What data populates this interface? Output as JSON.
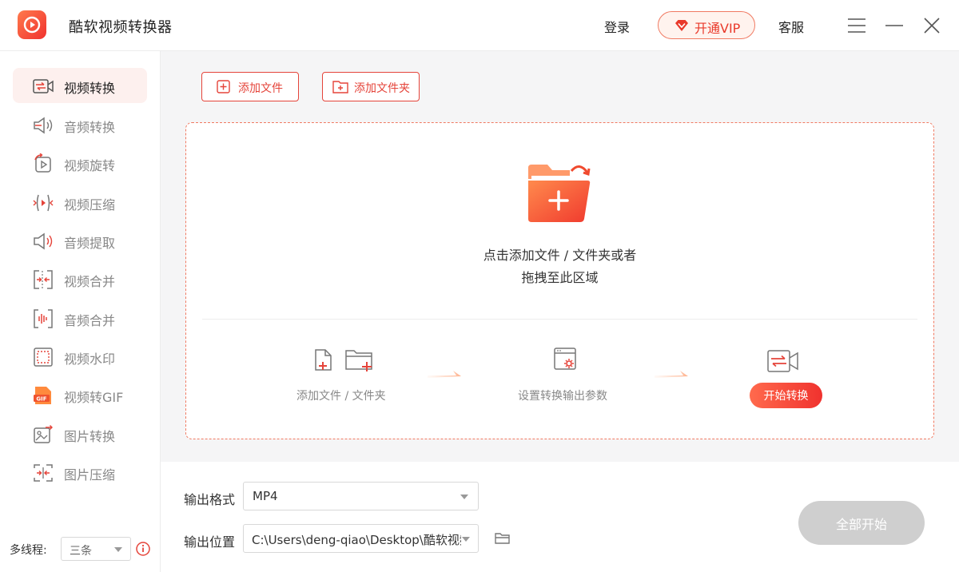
{
  "app": {
    "title": "酷软视频转换器"
  },
  "header": {
    "login": "登录",
    "vip": "开通VIP",
    "service": "客服"
  },
  "sidebar": {
    "items": [
      {
        "label": "视频转换",
        "icon": "video-convert-icon"
      },
      {
        "label": "音频转换",
        "icon": "audio-convert-icon"
      },
      {
        "label": "视频旋转",
        "icon": "video-rotate-icon"
      },
      {
        "label": "视频压缩",
        "icon": "video-compress-icon"
      },
      {
        "label": "音频提取",
        "icon": "audio-extract-icon"
      },
      {
        "label": "视频合并",
        "icon": "video-merge-icon"
      },
      {
        "label": "音频合并",
        "icon": "audio-merge-icon"
      },
      {
        "label": "视频水印",
        "icon": "video-watermark-icon"
      },
      {
        "label": "视频转GIF",
        "icon": "gif-icon"
      },
      {
        "label": "图片转换",
        "icon": "image-convert-icon"
      },
      {
        "label": "图片压缩",
        "icon": "image-compress-icon"
      }
    ],
    "active_index": 0,
    "thread_label": "多线程:",
    "thread_value": "三条"
  },
  "toolbar": {
    "add_file": "添加文件",
    "add_folder": "添加文件夹"
  },
  "dropzone": {
    "hint_line1": "点击添加文件 / 文件夹或者",
    "hint_line2": "拖拽至此区域",
    "step1": "添加文件 / 文件夹",
    "step2": "设置转换输出参数",
    "step3_button": "开始转换"
  },
  "output": {
    "format_label": "输出格式",
    "format_value": "MP4",
    "location_label": "输出位置",
    "location_value": "C:\\Users\\deng-qiao\\Desktop\\酷软视频转换器",
    "start_all": "全部开始"
  },
  "colors": {
    "accent": "#e5443a",
    "accent_light": "#ff7a4d",
    "active_bg": "#fdf0ee",
    "disabled_button": "#cfcfcf"
  }
}
